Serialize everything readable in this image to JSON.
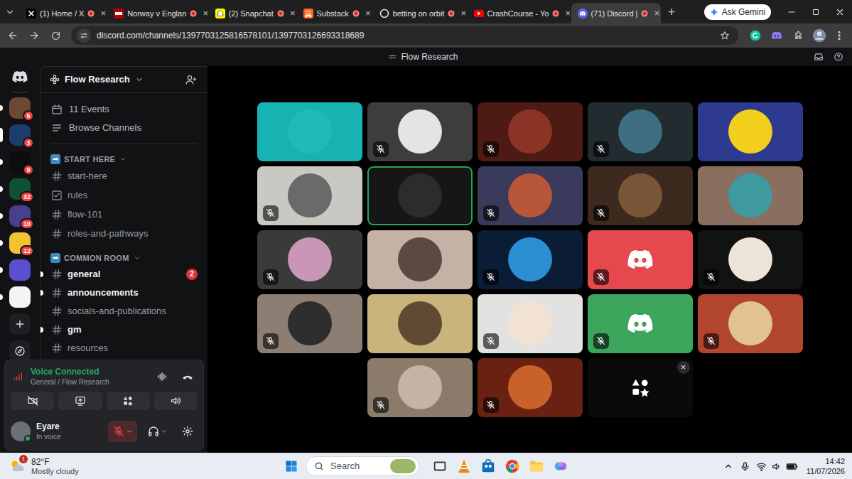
{
  "browser": {
    "tabs": [
      {
        "label": "(1) Home / X",
        "kind": "x",
        "selected": false,
        "recording": false,
        "close": "×"
      },
      {
        "label": "Norway v Englan",
        "kind": "bbc",
        "selected": false,
        "recording": false,
        "close": "×"
      },
      {
        "label": "(2) Snapchat",
        "kind": "snapchat",
        "selected": false,
        "recording": false,
        "close": "×"
      },
      {
        "label": "Substack",
        "kind": "substack",
        "selected": false,
        "recording": false,
        "close": "×"
      },
      {
        "label": "betting on orbit",
        "kind": "chatgpt",
        "selected": false,
        "recording": false,
        "close": "×"
      },
      {
        "label": "CrashCourse - Yo",
        "kind": "youtube",
        "selected": false,
        "recording": false,
        "close": "×"
      },
      {
        "label": "(71) Discord |",
        "kind": "discord",
        "selected": true,
        "recording": true,
        "close": "×"
      }
    ],
    "new_tab": "+",
    "gemini": "Ask Gemini",
    "url": "discord.com/channels/1397703125816578101/1397703126693318689"
  },
  "app": {
    "title": "Flow Research"
  },
  "servers": [
    {
      "color": "#6b4a35",
      "badge": "5",
      "unread": true,
      "selected": false
    },
    {
      "color": "#1c3c6e",
      "badge": "3",
      "unread": true,
      "selected": true
    },
    {
      "color": "#0d0d0d",
      "badge": "9",
      "unread": true,
      "selected": false
    },
    {
      "color": "#0f5132",
      "badge": "32",
      "unread": true,
      "selected": false
    },
    {
      "color": "#4a3f8f",
      "badge": "10",
      "unread": true,
      "selected": false
    },
    {
      "color": "#f2c230",
      "badge": "12",
      "unread": true,
      "selected": false
    },
    {
      "color": "#5a4fcf",
      "unread": true,
      "selected": false
    },
    {
      "color": "#f4f4f4",
      "unread": true,
      "selected": false
    }
  ],
  "server": {
    "name": "Flow Research"
  },
  "nav": [
    {
      "label": "11 Events",
      "kind": "events"
    },
    {
      "label": "Browse Channels",
      "kind": "browse"
    }
  ],
  "categories": [
    {
      "icon": "➡",
      "label": "START HERE",
      "channels": [
        {
          "name": "start-here",
          "kind": "text",
          "unread": false
        },
        {
          "name": "rules",
          "kind": "rules",
          "unread": false
        },
        {
          "name": "flow-101",
          "kind": "text",
          "unread": false
        },
        {
          "name": "roles-and-pathways",
          "kind": "text",
          "unread": false
        }
      ]
    },
    {
      "icon": "➡",
      "label": "COMMON ROOM",
      "channels": [
        {
          "name": "general",
          "kind": "text",
          "unread": true,
          "badge": "2"
        },
        {
          "name": "announcements",
          "kind": "text",
          "unread": true
        },
        {
          "name": "socials-and-publications",
          "kind": "text",
          "unread": false
        },
        {
          "name": "gm",
          "kind": "text",
          "unread": true
        },
        {
          "name": "resources",
          "kind": "text",
          "unread": false
        }
      ]
    }
  ],
  "voice_panel": {
    "status": "Voice Connected",
    "channel": "General / Flow Research"
  },
  "user": {
    "name": "Eyare",
    "status": "In voice",
    "muted": true
  },
  "participants": [
    {
      "kind": "avatar",
      "color": "#17b3b3",
      "avatar": "#20baba",
      "muted": false,
      "speaking": false
    },
    {
      "kind": "avatar",
      "color": "#3d3d3d",
      "avatar": "#e4e4e4",
      "muted": true,
      "speaking": false
    },
    {
      "kind": "avatar",
      "color": "#4e1a14",
      "avatar": "#8b3324",
      "muted": true,
      "speaking": false
    },
    {
      "kind": "avatar",
      "color": "#222b2f",
      "avatar": "#3f6e80",
      "muted": true,
      "speaking": false
    },
    {
      "kind": "avatar",
      "color": "#2d3a8f",
      "avatar": "#f2cf1d",
      "muted": false,
      "speaking": false
    },
    {
      "kind": "avatar",
      "color": "#c9c8c3",
      "avatar": "#6a6a6a",
      "muted": true,
      "speaking": false
    },
    {
      "kind": "avatar",
      "color": "#161616",
      "avatar": "#2c2c2c",
      "muted": false,
      "speaking": true
    },
    {
      "kind": "avatar",
      "color": "#393a5c",
      "avatar": "#b8563a",
      "muted": true,
      "speaking": false
    },
    {
      "kind": "avatar",
      "color": "#3b2a1d",
      "avatar": "#7a5638",
      "muted": true,
      "speaking": false
    },
    {
      "kind": "avatar",
      "color": "#8a6f60",
      "avatar": "#3f9aa0",
      "muted": false,
      "speaking": false
    },
    {
      "kind": "avatar",
      "color": "#3a3a3a",
      "avatar": "#c996b6",
      "muted": true,
      "speaking": false
    },
    {
      "kind": "avatar",
      "color": "#c4b2a6",
      "avatar": "#5b4a3f",
      "muted": false,
      "speaking": false
    },
    {
      "kind": "avatar",
      "color": "#0b1d36",
      "avatar": "#2a8fd0",
      "muted": true,
      "speaking": false
    },
    {
      "kind": "discord",
      "color": "#e5484d",
      "muted": true,
      "speaking": false
    },
    {
      "kind": "avatar",
      "color": "#121212",
      "avatar": "#ece4d6",
      "muted": true,
      "speaking": false
    },
    {
      "kind": "avatar",
      "color": "#8c7e72",
      "avatar": "#2e2e2e",
      "muted": true,
      "speaking": false
    },
    {
      "kind": "avatar",
      "color": "#c9b57c",
      "avatar": "#5e4b31",
      "muted": false,
      "speaking": false
    },
    {
      "kind": "avatar",
      "color": "#e2e2e2",
      "avatar": "#f1e2d3",
      "muted": true,
      "speaking": false
    },
    {
      "kind": "discord",
      "color": "#3ba55c",
      "muted": true,
      "speaking": false
    },
    {
      "kind": "avatar",
      "color": "#b2452d",
      "avatar": "#e1c393",
      "muted": true,
      "speaking": false
    },
    {
      "kind": "avatar",
      "color": "#8b7b6b",
      "avatar": "#c3b4a4",
      "muted": true,
      "speaking": false
    },
    {
      "kind": "avatar",
      "color": "#6b2112",
      "avatar": "#c8622a",
      "muted": true,
      "speaking": false
    },
    {
      "kind": "activity",
      "color": "#0a0a0b",
      "close": "×"
    }
  ],
  "taskbar": {
    "weather_badge": "1",
    "temperature": "82°F",
    "condition": "Mostly cloudy",
    "search": "Search",
    "time": "14:42",
    "date": "11/07/2026"
  }
}
